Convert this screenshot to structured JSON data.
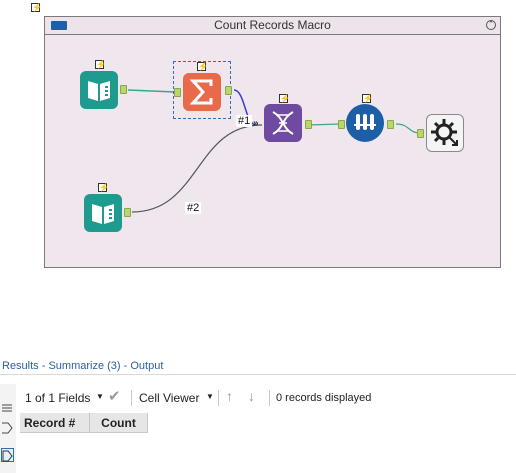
{
  "canvas": {
    "container_title": "Count Records Macro",
    "collapse_glyph": "⌃",
    "tools": [
      {
        "name": "macro-input-1",
        "icon": "macro-input-icon",
        "color": "#1f9a8e"
      },
      {
        "name": "summarize",
        "icon": "summarize-sigma-icon",
        "color": "#e86a4a"
      },
      {
        "name": "append-fields",
        "icon": "dna-append-icon",
        "color": "#6e4aa0"
      },
      {
        "name": "formula-tubes",
        "icon": "test-tubes-icon",
        "color": "#1d5fa7"
      },
      {
        "name": "macro-output",
        "icon": "gear-output-icon",
        "color": "#555555"
      },
      {
        "name": "macro-input-2",
        "icon": "macro-input-icon",
        "color": "#1f9a8e"
      }
    ],
    "connection_labels": [
      "#1",
      "#2"
    ]
  },
  "results": {
    "title": "Results - Summarize (3) - Output",
    "fields_selector": "1 of 1 Fields",
    "cell_viewer": "Cell Viewer",
    "records_status": "0 records displayed",
    "columns": [
      "Record #",
      "Count"
    ]
  },
  "colors": {
    "container_bg": "#efe6ee",
    "link_blue": "#2d5e9e",
    "anchor_green": "#b6d86a"
  }
}
